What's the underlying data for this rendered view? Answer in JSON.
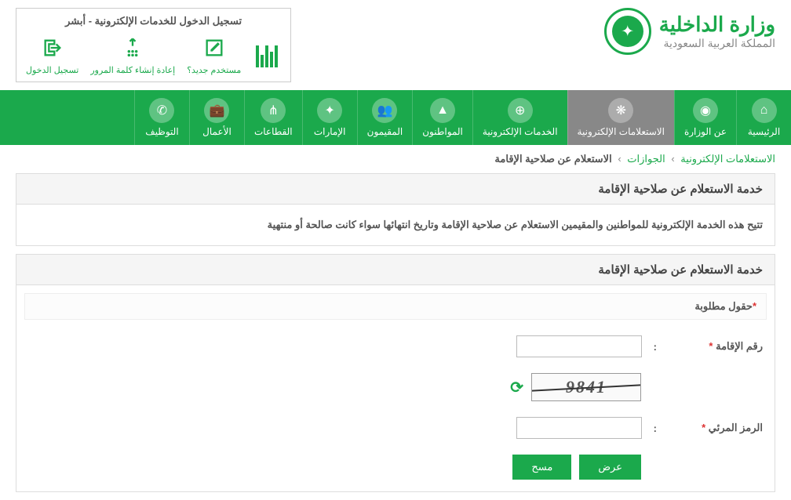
{
  "header": {
    "logo_title": "وزارة الداخلية",
    "logo_subtitle": "المملكة العربية السعودية",
    "absher_title": "تسجيل الدخول للخدمات الإلكترونية - أبشر",
    "absher_items": [
      {
        "label": "مستخدم جديد؟",
        "icon": "edit"
      },
      {
        "label": "إعادة إنشاء كلمة المرور",
        "icon": "touch"
      },
      {
        "label": "تسجيل الدخول",
        "icon": "login"
      }
    ]
  },
  "nav": [
    {
      "label": "الرئيسية",
      "icon": "home"
    },
    {
      "label": "عن الوزارة",
      "icon": "emblem"
    },
    {
      "label": "الاستعلامات الإلكترونية",
      "icon": "inquiry",
      "active": true
    },
    {
      "label": "الخدمات الإلكترونية",
      "icon": "globe"
    },
    {
      "label": "المواطنون",
      "icon": "citizen"
    },
    {
      "label": "المقيمون",
      "icon": "residents"
    },
    {
      "label": "الإمارات",
      "icon": "emirates"
    },
    {
      "label": "القطاعات",
      "icon": "sectors"
    },
    {
      "label": "الأعمال",
      "icon": "business"
    },
    {
      "label": "التوظيف",
      "icon": "jobs"
    }
  ],
  "breadcrumb": {
    "link1": "الاستعلامات الإلكترونية",
    "link2": "الجوازات",
    "current": "الاستعلام عن صلاحية الإقامة"
  },
  "service": {
    "title": "خدمة الاستعلام عن صلاحية الإقامة",
    "description": "تتيح هذه الخدمة الإلكترونية للمواطنين والمقيمين الاستعلام عن صلاحية الإقامة وتاريخ انتهائها سواء كانت صالحة أو منتهية"
  },
  "form": {
    "title": "خدمة الاستعلام عن صلاحية الإقامة",
    "required_note": "حقول مطلوبة",
    "iqama_label": "رقم الإقامة",
    "captcha_label": "الرمز المرئي",
    "captcha_value": "9841",
    "submit_label": "عرض",
    "clear_label": "مسح"
  }
}
